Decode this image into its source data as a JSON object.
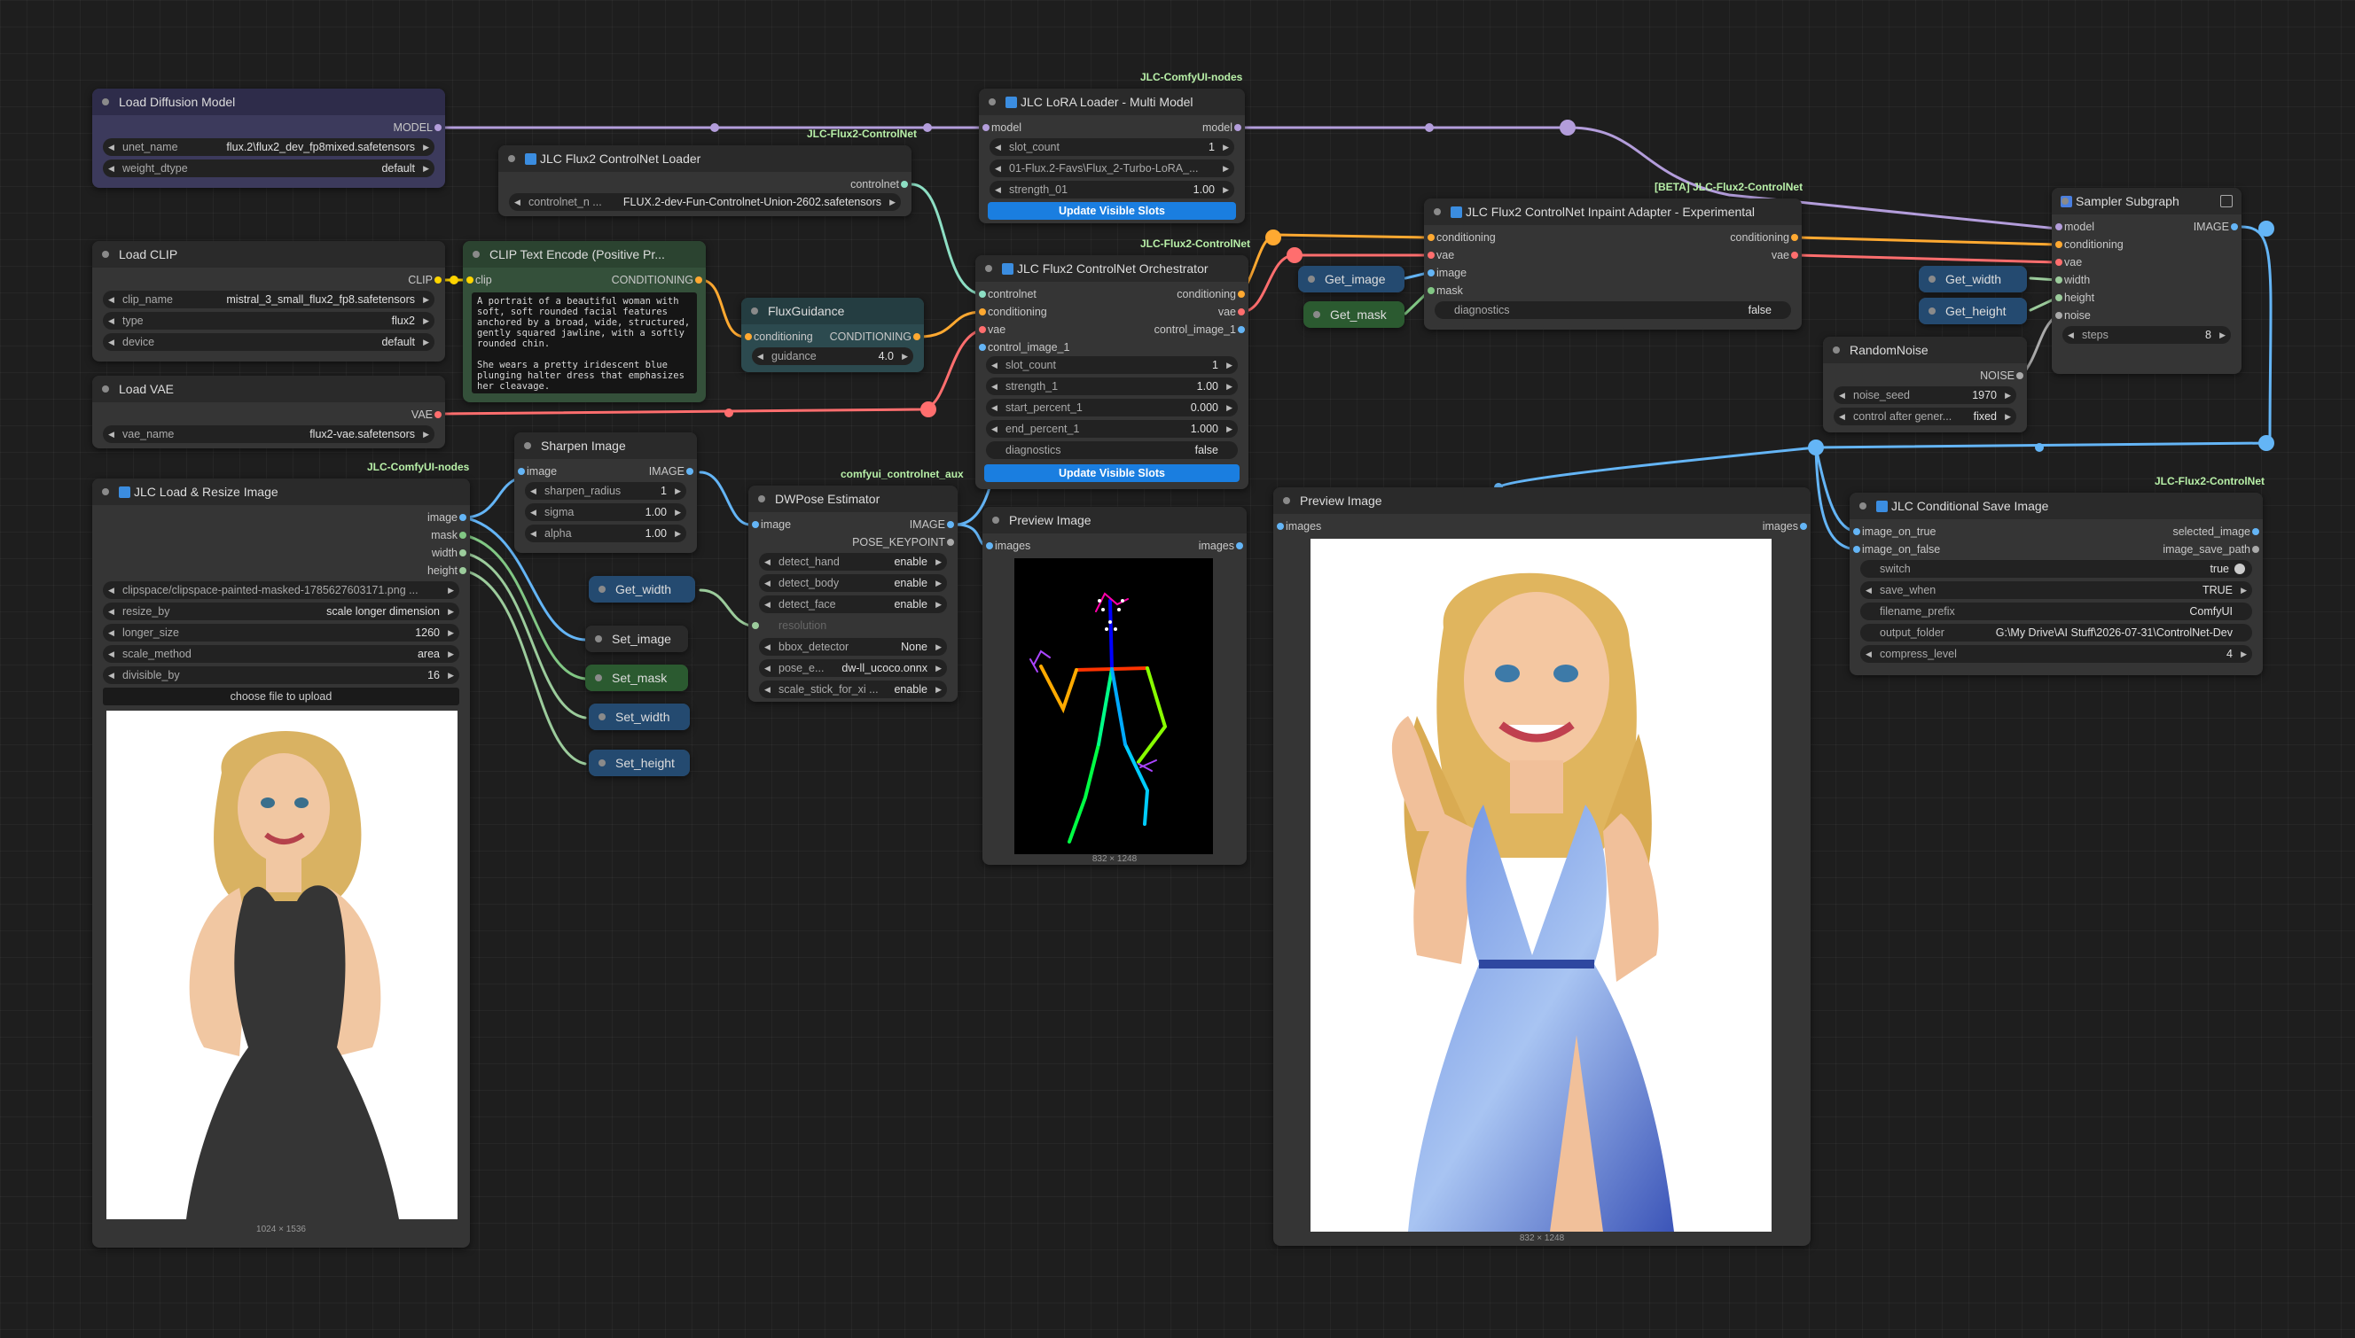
{
  "colors": {
    "model": "#b39ddb",
    "clip": "#ffd500",
    "vae": "#ff6e6e",
    "conditioning": "#ffa931",
    "image": "#64b5f6",
    "mask": "#81c784",
    "control": "#8ddfc4"
  },
  "tags": {
    "lora": "JLC-ComfyUI-nodes",
    "cn_loader": "JLC-Flux2-ControlNet",
    "orch": "JLC-Flux2-ControlNet",
    "inpaint": "[BETA] JLC-Flux2-ControlNet",
    "load_resize": "JLC-ComfyUI-nodes",
    "dwpose": "comfyui_controlnet_aux",
    "cond_save": "JLC-Flux2-ControlNet"
  },
  "load_diffusion": {
    "title": "Load Diffusion Model",
    "out_model": "MODEL",
    "w1_label": "unet_name",
    "w1_value": "flux.2\\flux2_dev_fp8mixed.safetensors",
    "w2_label": "weight_dtype",
    "w2_value": "default"
  },
  "load_clip": {
    "title": "Load CLIP",
    "out_clip": "CLIP",
    "w1_label": "clip_name",
    "w1_value": "mistral_3_small_flux2_fp8.safetensors",
    "w2_label": "type",
    "w2_value": "flux2",
    "w3_label": "device",
    "w3_value": "default"
  },
  "load_vae": {
    "title": "Load VAE",
    "out_vae": "VAE",
    "w1_label": "vae_name",
    "w1_value": "flux2-vae.safetensors"
  },
  "cn_loader": {
    "title": "JLC Flux2 ControlNet Loader",
    "out": "controlnet",
    "w1_label": "controlnet_n ...",
    "w1_value": "FLUX.2-dev-Fun-Controlnet-Union-2602.safetensors"
  },
  "clip_encode": {
    "title": "CLIP Text Encode (Positive Pr...",
    "in_clip": "clip",
    "out": "CONDITIONING",
    "text": "A portrait of a beautiful woman with soft, soft rounded facial features anchored by a broad, wide, structured, gently squared jawline, with a softly rounded chin.\n\nShe wears a pretty iridescent blue plunging halter dress that emphasizes her cleavage."
  },
  "flux_guidance": {
    "title": "FluxGuidance",
    "in": "conditioning",
    "out": "CONDITIONING",
    "w1_label": "guidance",
    "w1_value": "4.0"
  },
  "lora": {
    "title": "JLC LoRA Loader - Multi Model",
    "in": "model",
    "out": "model",
    "w1_label": "slot_count",
    "w1_value": "1",
    "w2_value": "01-Flux.2-Favs\\Flux_2-Turbo-LoRA_...",
    "w3_label": "strength_01",
    "w3_value": "1.00",
    "button": "Update Visible Slots"
  },
  "orch": {
    "title": "JLC Flux2 ControlNet Orchestrator",
    "in1": "controlnet",
    "in2": "conditioning",
    "in3": "vae",
    "in4": "control_image_1",
    "out1": "conditioning",
    "out2": "vae",
    "out3": "control_image_1",
    "w1_label": "slot_count",
    "w1_value": "1",
    "w2_label": "strength_1",
    "w2_value": "1.00",
    "w3_label": "start_percent_1",
    "w3_value": "0.000",
    "w4_label": "end_percent_1",
    "w4_value": "1.000",
    "w5_label": "diagnostics",
    "w5_value": "false",
    "button": "Update Visible Slots"
  },
  "get_image": {
    "title": "Get_image"
  },
  "get_mask": {
    "title": "Get_mask"
  },
  "inpaint": {
    "title": "JLC Flux2 ControlNet Inpaint Adapter - Experimental",
    "in1": "conditioning",
    "in2": "vae",
    "in3": "image",
    "in4": "mask",
    "out1": "conditioning",
    "out2": "vae",
    "w1_label": "diagnostics",
    "w1_value": "false"
  },
  "get_width": {
    "title": "Get_width"
  },
  "get_height": {
    "title": "Get_height"
  },
  "sampler": {
    "title": "Sampler Subgraph",
    "out": "IMAGE",
    "in1": "model",
    "in2": "conditioning",
    "in3": "vae",
    "in4": "width",
    "in5": "height",
    "in6": "noise",
    "w1_label": "steps",
    "w1_value": "8"
  },
  "random_noise": {
    "title": "RandomNoise",
    "out": "NOISE",
    "w1_label": "noise_seed",
    "w1_value": "1970",
    "w2_label": "control after gener...",
    "w2_value": "fixed"
  },
  "sharpen": {
    "title": "Sharpen Image",
    "in": "image",
    "out": "IMAGE",
    "w1_label": "sharpen_radius",
    "w1_value": "1",
    "w2_label": "sigma",
    "w2_value": "1.00",
    "w3_label": "alpha",
    "w3_value": "1.00"
  },
  "load_resize": {
    "title": "JLC Load & Resize Image",
    "out1": "image",
    "out2": "mask",
    "out3": "width",
    "out4": "height",
    "w1_value": "clipspace/clipspace-painted-masked-1785627603171.png ...",
    "w2_label": "resize_by",
    "w2_value": "scale longer dimension",
    "w3_label": "longer_size",
    "w3_value": "1260",
    "w4_label": "scale_method",
    "w4_value": "area",
    "w5_label": "divisible_by",
    "w5_value": "16",
    "upload": "choose file to upload",
    "dim": "1024 × 1536"
  },
  "get_width2": {
    "title": "Get_width"
  },
  "set_image": {
    "title": "Set_image"
  },
  "set_mask": {
    "title": "Set_mask"
  },
  "set_width": {
    "title": "Set_width"
  },
  "set_height": {
    "title": "Set_height"
  },
  "dwpose": {
    "title": "DWPose Estimator",
    "in": "image",
    "out1": "IMAGE",
    "out2": "POSE_KEYPOINT",
    "w1_label": "detect_hand",
    "w1_value": "enable",
    "w2_label": "detect_body",
    "w2_value": "enable",
    "w3_label": "detect_face",
    "w3_value": "enable",
    "w4_label": "resolution",
    "w5_label": "bbox_detector",
    "w5_value": "None",
    "w6_label": "pose_e...",
    "w6_value": "dw-ll_ucoco.onnx",
    "w7_label": "scale_stick_for_xi ...",
    "w7_value": "enable"
  },
  "preview1": {
    "title": "Preview Image",
    "in": "images",
    "out": "images",
    "dim": "832 × 1248"
  },
  "preview2": {
    "title": "Preview Image",
    "in": "images",
    "out": "images",
    "dim": "832 × 1248"
  },
  "cond_save": {
    "title": "JLC Conditional Save Image",
    "in1": "image_on_true",
    "in2": "image_on_false",
    "out1": "selected_image",
    "out2": "image_save_path",
    "w1_label": "switch",
    "w1_value": "true",
    "w2_label": "save_when",
    "w2_value": "TRUE",
    "w3_label": "filename_prefix",
    "w3_value": "ComfyUI",
    "w4_label": "output_folder",
    "w4_value": "G:\\My Drive\\AI Stuff\\2026-07-31\\ControlNet-Dev",
    "w5_label": "compress_level",
    "w5_value": "4"
  }
}
